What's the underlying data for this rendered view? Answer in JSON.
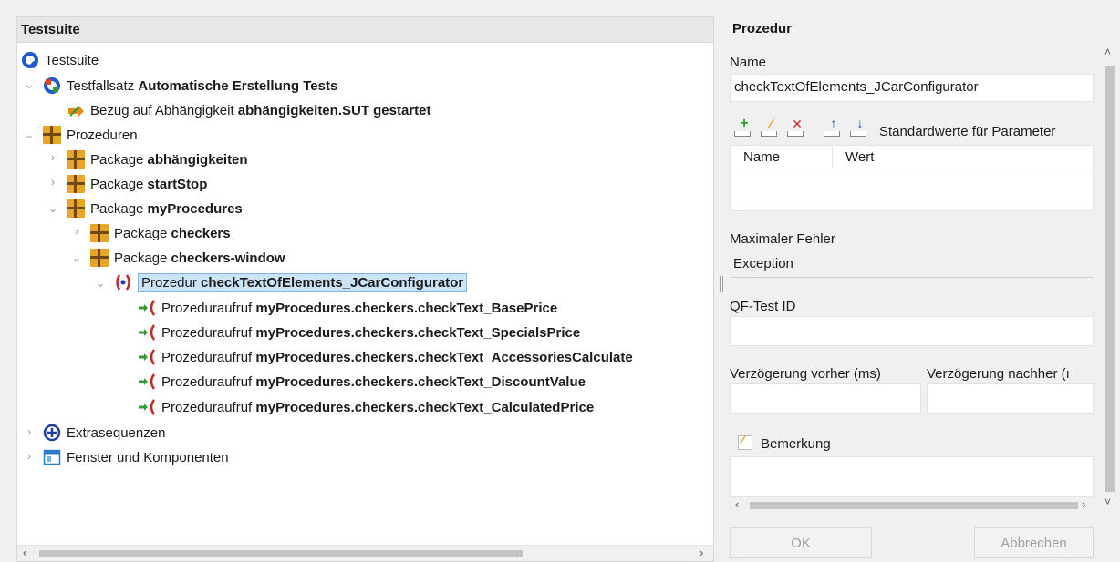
{
  "left": {
    "header": "Testsuite",
    "tree": {
      "root_label": "Testsuite",
      "testset_prefix": "Testfallsatz",
      "testset_name": "Automatische Erstellung Tests",
      "dep_prefix": "Bezug auf Abhängigkeit",
      "dep_name": "abhängigkeiten.SUT gestartet",
      "procedures_label": "Prozeduren",
      "pkg_prefix": "Package",
      "pkg1": "abhängigkeiten",
      "pkg2": "startStop",
      "pkg3": "myProcedures",
      "pkg4": "checkers",
      "pkg5": "checkers-window",
      "proc_prefix": "Prozedur",
      "proc_name": "checkTextOfElements_JCarConfigurator",
      "call_prefix": "Prozeduraufruf",
      "calls": [
        "myProcedures.checkers.checkText_BasePrice",
        "myProcedures.checkers.checkText_SpecialsPrice",
        "myProcedures.checkers.checkText_AccessoriesCalculate",
        "myProcedures.checkers.checkText_DiscountValue",
        "myProcedures.checkers.checkText_CalculatedPrice"
      ],
      "extras_label": "Extrasequenzen",
      "windows_label": "Fenster und Komponenten"
    }
  },
  "right": {
    "title": "Prozedur",
    "name_label": "Name",
    "name_value": "checkTextOfElements_JCarConfigurator",
    "defaults_label": "Standardwerte für Parameter",
    "table_col_name": "Name",
    "table_col_value": "Wert",
    "max_error_label": "Maximaler Fehler",
    "max_error_value": "Exception",
    "qf_id_label": "QF-Test ID",
    "delay_before_label": "Verzögerung vorher (ms)",
    "delay_after_label": "Verzögerung nachher (ı",
    "remark_label": "Bemerkung",
    "ok_label": "OK",
    "cancel_label": "Abbrechen"
  },
  "colors": {
    "selection_bg": "#cce4f7",
    "package_icon": "#e8a52a",
    "call_arrow": "#2e9e2e",
    "procedure_red": "#c0282a"
  }
}
